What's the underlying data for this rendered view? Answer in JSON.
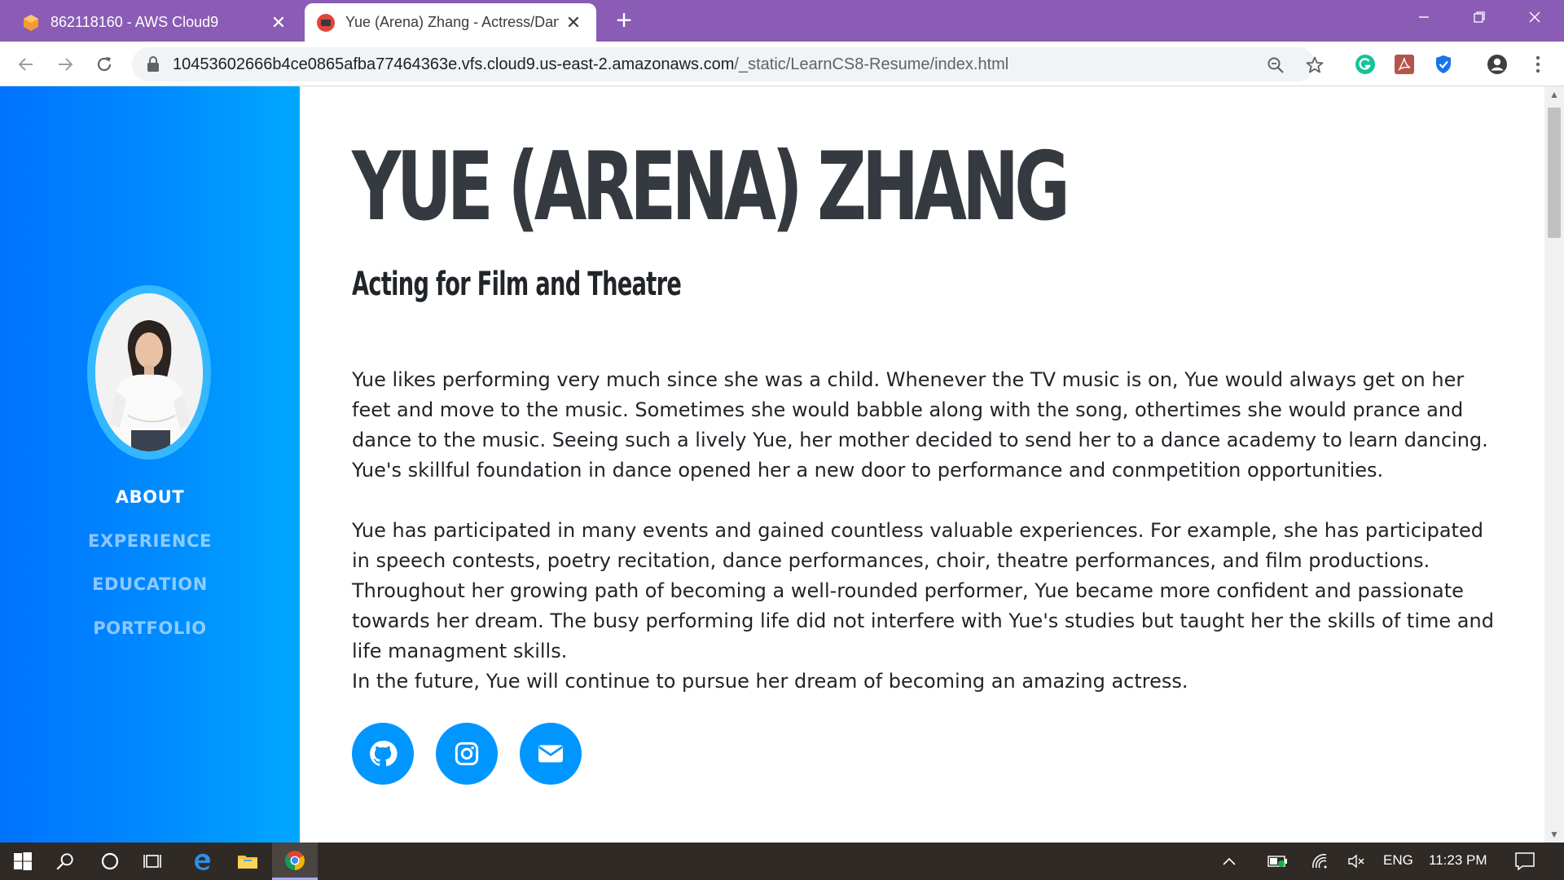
{
  "browser": {
    "tabs": [
      {
        "title": "862118160 - AWS Cloud9",
        "active": false
      },
      {
        "title": "Yue (Arena) Zhang - Actress/Dan",
        "active": true
      }
    ],
    "new_tab_label": "+",
    "url_host": "10453602666b4ce0865afba77464363e.vfs.cloud9.us-east-2.amazonaws.com",
    "url_path": "/_static/LearnCS8-Resume/index.html"
  },
  "sidebar": {
    "nav": [
      {
        "label": "ABOUT",
        "active": true
      },
      {
        "label": "EXPERIENCE",
        "active": false
      },
      {
        "label": "EDUCATION",
        "active": false
      },
      {
        "label": "PORTFOLIO",
        "active": false
      }
    ]
  },
  "main": {
    "name": "YUE (ARENA) ZHANG",
    "subtitle": "Acting for Film and Theatre",
    "paragraphs": [
      "Yue likes performing very much since she was a child. Whenever the TV music is on, Yue would always get on her feet and move to the music. Sometimes she would babble along with the song, othertimes she would prance and dance to the music. Seeing such a lively Yue, her mother decided to send her to a dance academy to learn dancing. Yue's skillful foundation in dance opened her a new door to performance and conmpetition opportunities.",
      "Yue has participated in many events and gained countless valuable experiences. For example, she has participated in speech contests, poetry recitation, dance performances, choir, theatre performances, and film productions. Throughout her growing path of becoming a well-rounded performer, Yue became more confident and passionate towards her dream. The busy performing life did not interfere with Yue's studies but taught her the skills of time and life managment skills.",
      "In the future, Yue will continue to pursue her dream of becoming an amazing actress."
    ],
    "social_icons": [
      "github-icon",
      "instagram-icon",
      "envelope-icon"
    ]
  },
  "taskbar": {
    "language": "ENG",
    "time": "11:23 PM"
  },
  "colors": {
    "accent": "#0096ff",
    "sidebar_start": "#0073ff",
    "sidebar_end": "#00a8ff",
    "chrome_frame": "#8a5cb5",
    "heading": "#343a40"
  }
}
